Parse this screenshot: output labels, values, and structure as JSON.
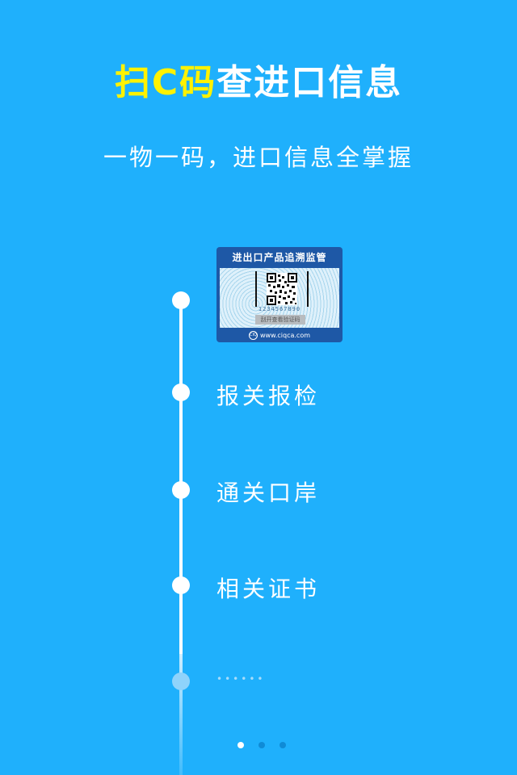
{
  "header": {
    "title_highlight": "扫C码",
    "title_rest": "查进口信息",
    "subtitle": "一物一码，进口信息全掌握"
  },
  "label_card": {
    "heading": "进出口产品追溯监管",
    "digits": "1234567890",
    "scratch_text": "刮开查看验证码",
    "site_logo_text": "CIQ",
    "site": "www.ciqca.com"
  },
  "timeline": {
    "items": [
      {
        "label": "报关报检"
      },
      {
        "label": "通关口岸"
      },
      {
        "label": "相关证书"
      }
    ],
    "more": "••••••"
  },
  "pager": {
    "count": 3,
    "active_index": 0
  },
  "colors": {
    "background": "#1fb0fc",
    "title_highlight": "#fff200",
    "card_blue": "#1e58a6",
    "pager_inactive": "#0f8bd6"
  },
  "icons": {
    "card_logo": "shield-logo-icon",
    "card_qr": "qr-code-icon"
  }
}
